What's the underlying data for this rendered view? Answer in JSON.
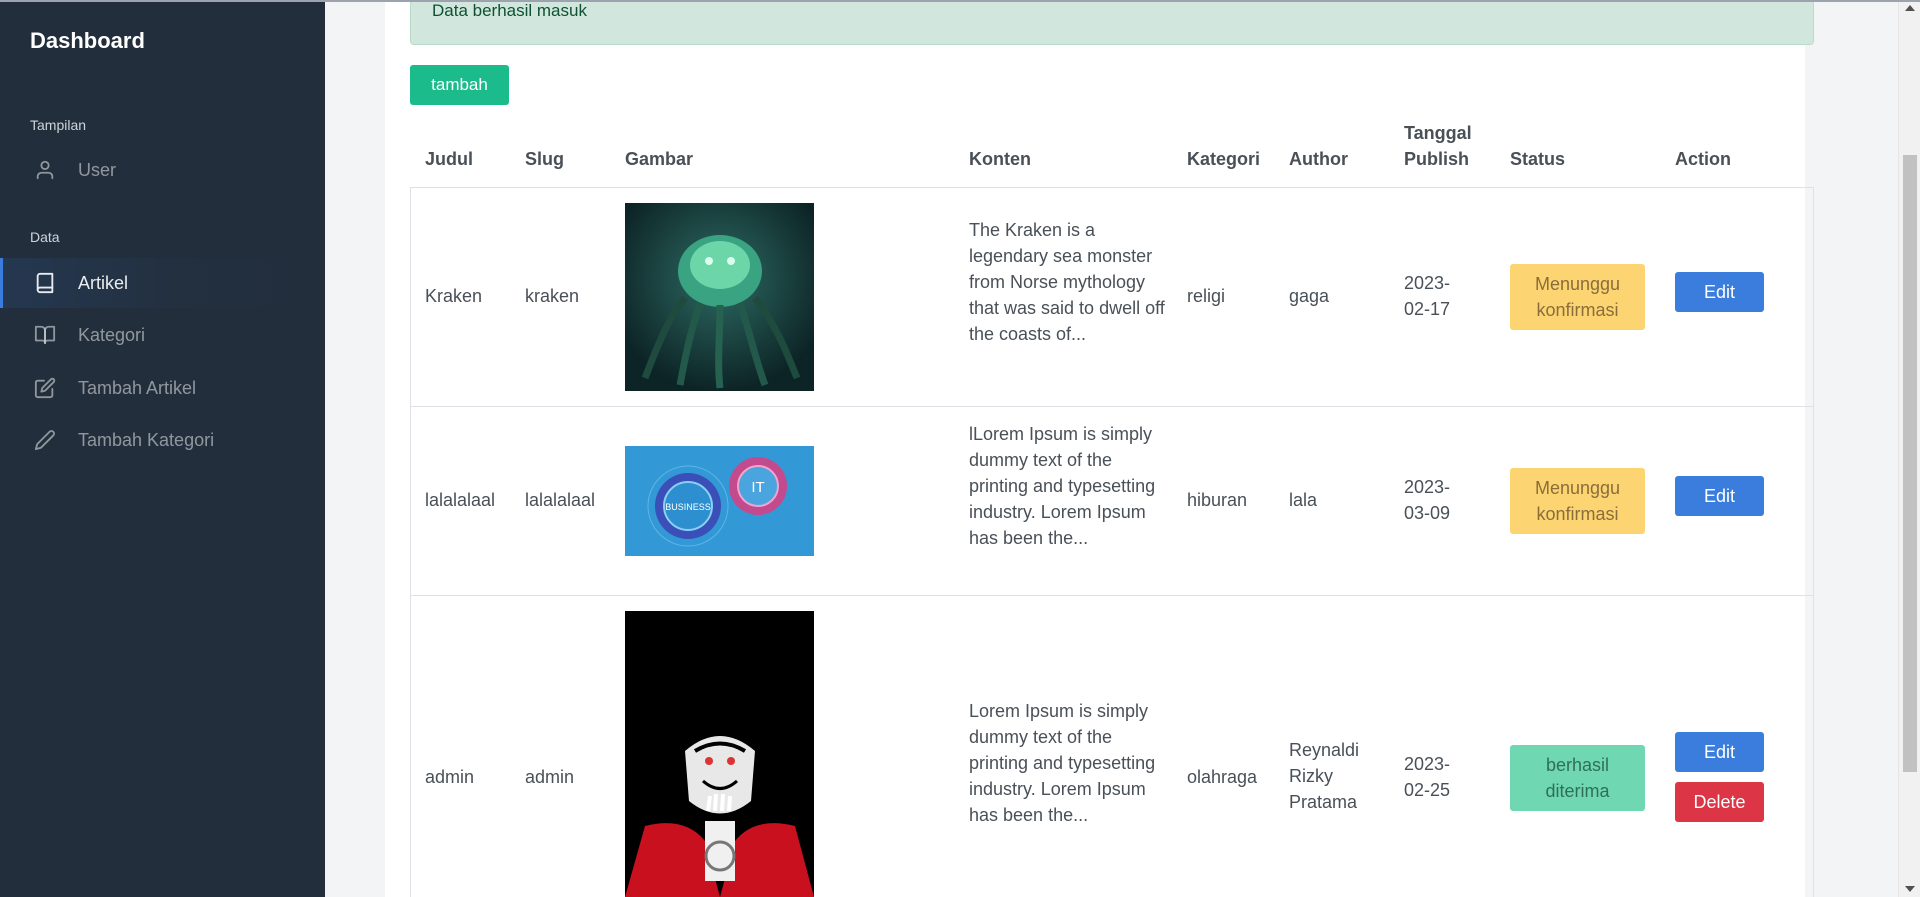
{
  "sidebar": {
    "brand": "Dashboard",
    "sections": [
      {
        "header": "Tampilan",
        "items": [
          {
            "label": "User",
            "icon": "user-icon"
          }
        ]
      },
      {
        "header": "Data",
        "items": [
          {
            "label": "Artikel",
            "icon": "book-icon",
            "active": true
          },
          {
            "label": "Kategori",
            "icon": "book-open-icon"
          },
          {
            "label": "Tambah Artikel",
            "icon": "edit-icon"
          },
          {
            "label": "Tambah Kategori",
            "icon": "pencil-icon"
          }
        ]
      }
    ]
  },
  "alert": {
    "text": "Data berhasil masuk"
  },
  "add_button": "tambah",
  "table": {
    "headers": [
      "Judul",
      "Slug",
      "Gambar",
      "Konten",
      "Kategori",
      "Author",
      "Tanggal Publish",
      "Status",
      "Action"
    ],
    "rows": [
      {
        "judul": "Kraken",
        "slug": "kraken",
        "image": "kraken-image",
        "konten": "The Kraken is a legendary sea monster from Norse mythology that was said to dwell off the coasts of...",
        "kategori": "religi",
        "author": "gaga",
        "tanggal": "2023-02-17",
        "status": "Menunggu konfirmasi",
        "actions": [
          "Edit"
        ]
      },
      {
        "judul": "lalalalaal",
        "slug": "lalalalaal",
        "image": "business-it-gears-image",
        "image_text": {
          "left": "BUSINESS",
          "right": "IT"
        },
        "konten": "lLorem Ipsum is simply dummy text of the printing and typesetting industry. Lorem Ipsum has been the...",
        "kategori": "hiburan",
        "author": "lala",
        "tanggal": "2023-03-09",
        "status": "Menunggu konfirmasi",
        "actions": [
          "Edit"
        ]
      },
      {
        "judul": "admin",
        "slug": "admin",
        "image": "vampire-character-image",
        "konten": "Lorem Ipsum is simply dummy text of the printing and typesetting industry. Lorem Ipsum has been the...",
        "kategori": "olahraga",
        "author": "Reynaldi Rizky Pratama",
        "tanggal": "2023-02-25",
        "status": "berhasil diterima",
        "actions": [
          "Edit",
          "Delete"
        ]
      }
    ]
  },
  "colors": {
    "sidebar": "#222e3c",
    "accent": "#3b7ddd",
    "success": "#1cbb8c",
    "warning_badge": "#fcd572",
    "success_badge": "#6fd8b2",
    "danger": "#dc3545"
  }
}
